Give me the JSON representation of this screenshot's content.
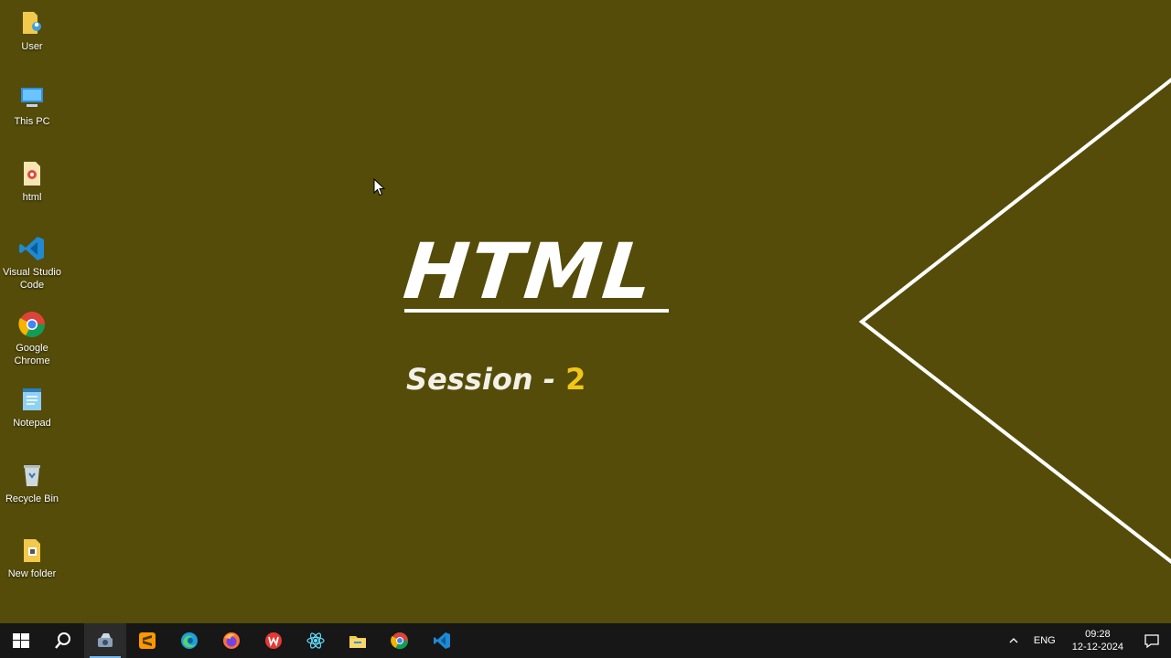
{
  "desktop": {
    "icons": [
      {
        "label": "User",
        "icon": "user-folder-icon"
      },
      {
        "label": "This PC",
        "icon": "computer-icon"
      },
      {
        "label": "html",
        "icon": "html-file-icon"
      },
      {
        "label": "Visual Studio Code",
        "icon": "vscode-icon"
      },
      {
        "label": "Google Chrome",
        "icon": "chrome-icon"
      },
      {
        "label": "Notepad",
        "icon": "notepad-icon"
      },
      {
        "label": "Recycle Bin",
        "icon": "recycle-bin-icon"
      },
      {
        "label": "New folder",
        "icon": "folder-icon"
      }
    ]
  },
  "slide": {
    "title": "HTML",
    "subtitle_text": "Session - ",
    "subtitle_number": "2",
    "colors": {
      "background": "#544c08",
      "accent": "#f2c617",
      "text": "#ffffff"
    }
  },
  "taskbar": {
    "apps": [
      "start-icon",
      "search-icon",
      "snipping-tool-icon",
      "sublime-text-icon",
      "edge-icon",
      "firefox-icon",
      "wps-office-icon",
      "react-icon",
      "file-explorer-icon",
      "chrome-icon",
      "vscode-icon"
    ],
    "tray": {
      "language": "ENG",
      "time": "09:28",
      "date": "12-12-2024"
    }
  }
}
